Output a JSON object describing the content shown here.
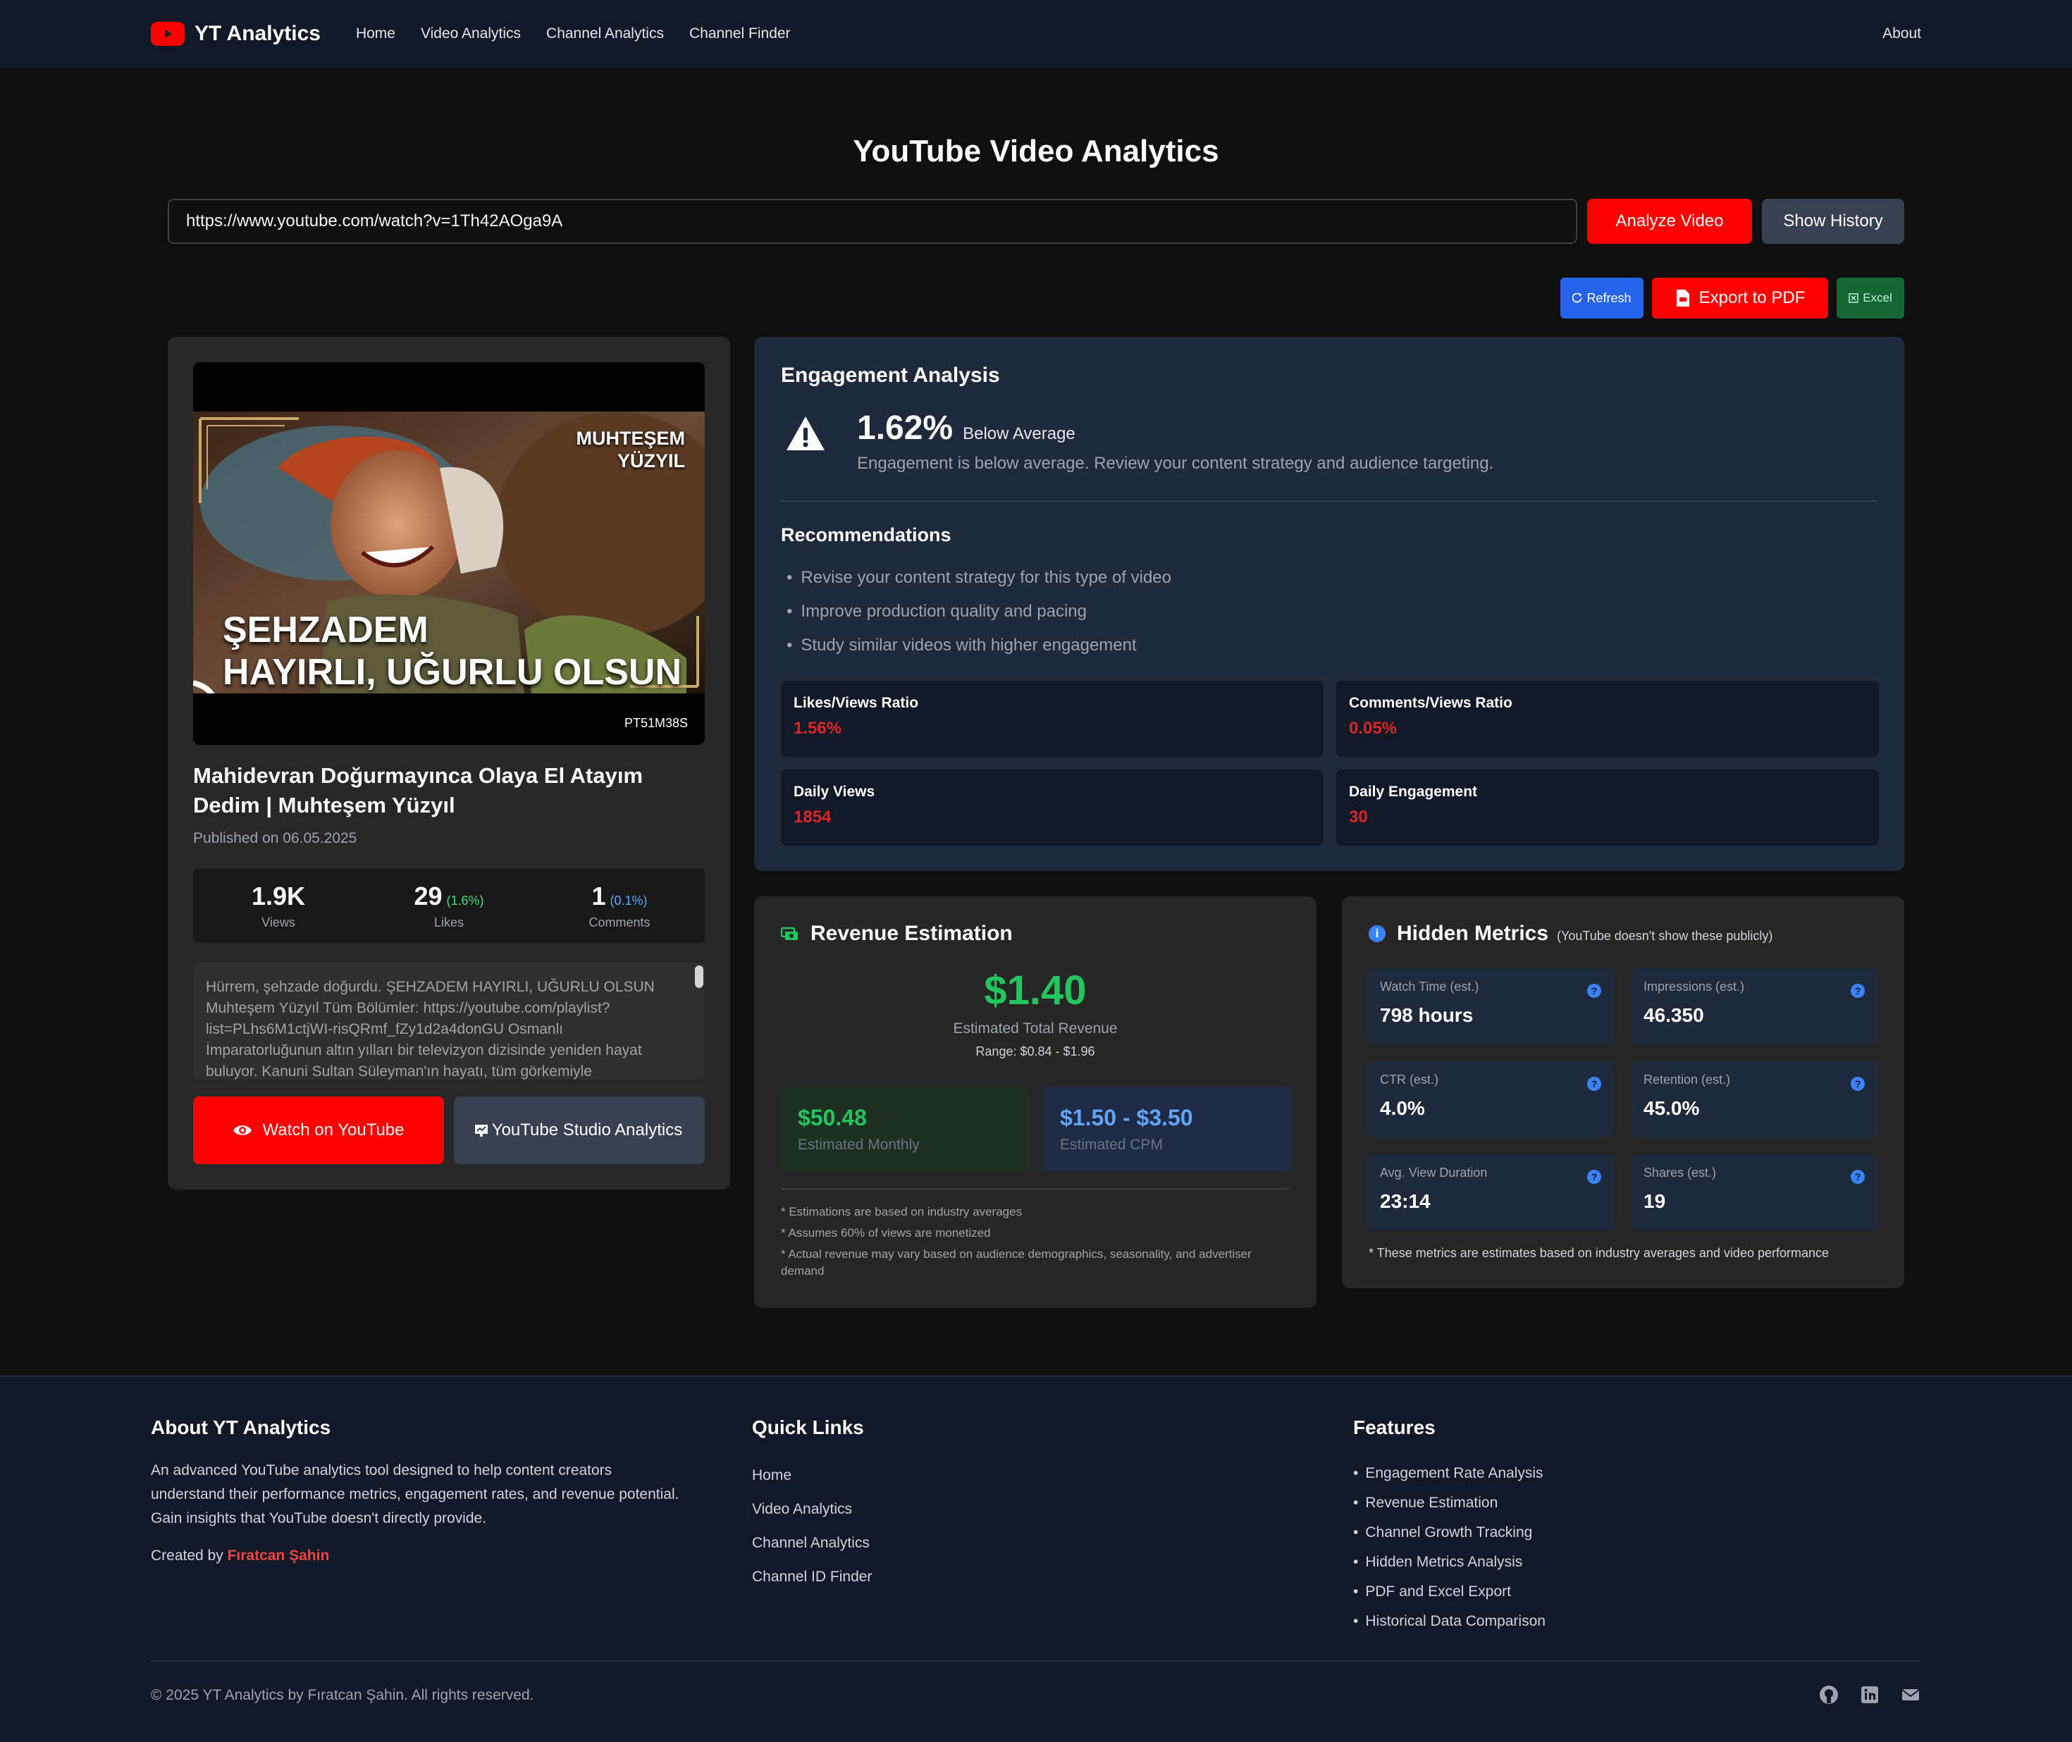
{
  "nav": {
    "brand": "YT Analytics",
    "links": [
      "Home",
      "Video Analytics",
      "Channel Analytics",
      "Channel Finder"
    ],
    "about": "About"
  },
  "hero": {
    "title": "YouTube Video Analytics",
    "url_value": "https://www.youtube.com/watch?v=1Th42AOga9A",
    "analyze_label": "Analyze Video",
    "history_label": "Show History"
  },
  "actions": {
    "refresh_label": "Refresh",
    "pdf_label": "Export to PDF",
    "excel_label": "Excel"
  },
  "video": {
    "thumb_brand_line1": "MUHTEŞEM",
    "thumb_brand_line2": "YÜZYIL",
    "thumb_caption_line1": "ŞEHZADEM",
    "thumb_caption_line2": "HAYIRLI, UĞURLU OLSUN",
    "duration": "PT51M38S",
    "title": "Mahidevran Doğurmayınca Olaya El Atayım Dedim | Muhteşem Yüzyıl",
    "published": "Published on 06.05.2025",
    "stats": [
      {
        "value": "1.9K",
        "pct": "",
        "label": "Views"
      },
      {
        "value": "29",
        "pct": "(1.6%)",
        "label": "Likes"
      },
      {
        "value": "1",
        "pct": "(0.1%)",
        "label": "Comments"
      }
    ],
    "description": "Hürrem, şehzade doğurdu. ŞEHZADEM HAYIRLI, UĞURLU OLSUN Muhteşem Yüzyıl Tüm Bölümler: https://youtube.com/playlist?list=PLhs6M1ctjWI-risQRmf_fZy1d2a4donGU Osmanlı İmparatorluğunun altın yılları bir televizyon dizisinde yeniden hayat buluyor. Kanuni Sultan Süleyman'ın hayatı, tüm görkemiyle",
    "watch_label": "Watch on YouTube",
    "studio_label": "YouTube Studio Analytics"
  },
  "engagement": {
    "title": "Engagement Analysis",
    "rate": "1.62%",
    "rating": "Below Average",
    "message": "Engagement is below average. Review your content strategy and audience targeting.",
    "rec_title": "Recommendations",
    "recommendations": [
      "Revise your content strategy for this type of video",
      "Improve production quality and pacing",
      "Study similar videos with higher engagement"
    ],
    "metrics": [
      {
        "label": "Likes/Views Ratio",
        "value": "1.56%"
      },
      {
        "label": "Comments/Views Ratio",
        "value": "0.05%"
      },
      {
        "label": "Daily Views",
        "value": "1854"
      },
      {
        "label": "Daily Engagement",
        "value": "30"
      }
    ]
  },
  "revenue": {
    "title": "Revenue Estimation",
    "total": "$1.40",
    "total_label": "Estimated Total Revenue",
    "range": "Range: $0.84 - $1.96",
    "monthly_value": "$50.48",
    "monthly_label": "Estimated Monthly",
    "cpm_value": "$1.50 - $3.50",
    "cpm_label": "Estimated CPM",
    "notes": [
      "* Estimations are based on industry averages",
      "* Assumes 60% of views are monetized",
      "* Actual revenue may vary based on audience demographics, seasonality, and advertiser demand"
    ]
  },
  "hidden": {
    "title": "Hidden Metrics",
    "subtitle": "(YouTube doesn't show these publicly)",
    "metrics": [
      {
        "label": "Watch Time (est.)",
        "value": "798 hours"
      },
      {
        "label": "Impressions (est.)",
        "value": "46.350"
      },
      {
        "label": "CTR (est.)",
        "value": "4.0%"
      },
      {
        "label": "Retention (est.)",
        "value": "45.0%"
      },
      {
        "label": "Avg. View Duration",
        "value": "23:14"
      },
      {
        "label": "Shares (est.)",
        "value": "19"
      }
    ],
    "footnote": "* These metrics are estimates based on industry averages and video performance"
  },
  "footer": {
    "about_title": "About YT Analytics",
    "about_text": "An advanced YouTube analytics tool designed to help content creators understand their performance metrics, engagement rates, and revenue potential. Gain insights that YouTube doesn't directly provide.",
    "created_prefix": "Created by ",
    "author": "Fıratcan Şahin",
    "links_title": "Quick Links",
    "links": [
      "Home",
      "Video Analytics",
      "Channel Analytics",
      "Channel ID Finder"
    ],
    "features_title": "Features",
    "features": [
      "Engagement Rate Analysis",
      "Revenue Estimation",
      "Channel Growth Tracking",
      "Hidden Metrics Analysis",
      "PDF and Excel Export",
      "Historical Data Comparison"
    ],
    "copyright": "© 2025 YT Analytics by Fıratcan Şahin. All rights reserved."
  },
  "icons": {
    "brand": "youtube-play-icon",
    "refresh": "refresh-icon",
    "pdf": "pdf-file-icon",
    "excel": "excel-icon",
    "watch": "eye-icon",
    "studio": "studio-chart-icon",
    "warning": "warning-triangle-icon",
    "revenue": "money-icon",
    "info": "info-icon",
    "social": [
      "github-icon",
      "linkedin-icon",
      "email-icon"
    ]
  },
  "colors": {
    "brand_red": "#ff0000",
    "positive_green": "#22c55e",
    "metric_red": "#dc2626",
    "accent_blue": "#3b82f6"
  }
}
